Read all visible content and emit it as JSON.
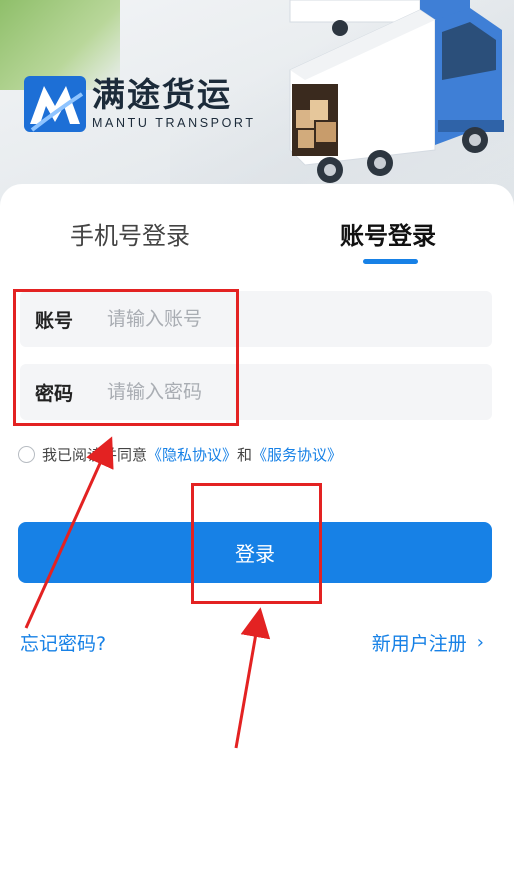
{
  "brand": {
    "name_cn": "满途货运",
    "name_en": "MANTU TRANSPORT"
  },
  "tabs": [
    {
      "label": "手机号登录",
      "active": false
    },
    {
      "label": "账号登录",
      "active": true
    }
  ],
  "form": {
    "account_label": "账号",
    "account_placeholder": "请输入账号",
    "account_value": "",
    "password_label": "密码",
    "password_placeholder": "请输入密码",
    "password_value": ""
  },
  "agreement": {
    "checked": false,
    "prefix": "我已阅读并同意",
    "privacy": "《隐私协议》",
    "and": "和",
    "service": "《服务协议》"
  },
  "login_button": "登录",
  "forgot_password": "忘记密码?",
  "register": "新用户注册",
  "icons": {
    "logo": "mantu-logo-icon",
    "truck": "truck-illustration",
    "register_chevron": "chevron-right-icon"
  },
  "colors": {
    "accent": "#1781e6",
    "annotation": "#e32222"
  }
}
